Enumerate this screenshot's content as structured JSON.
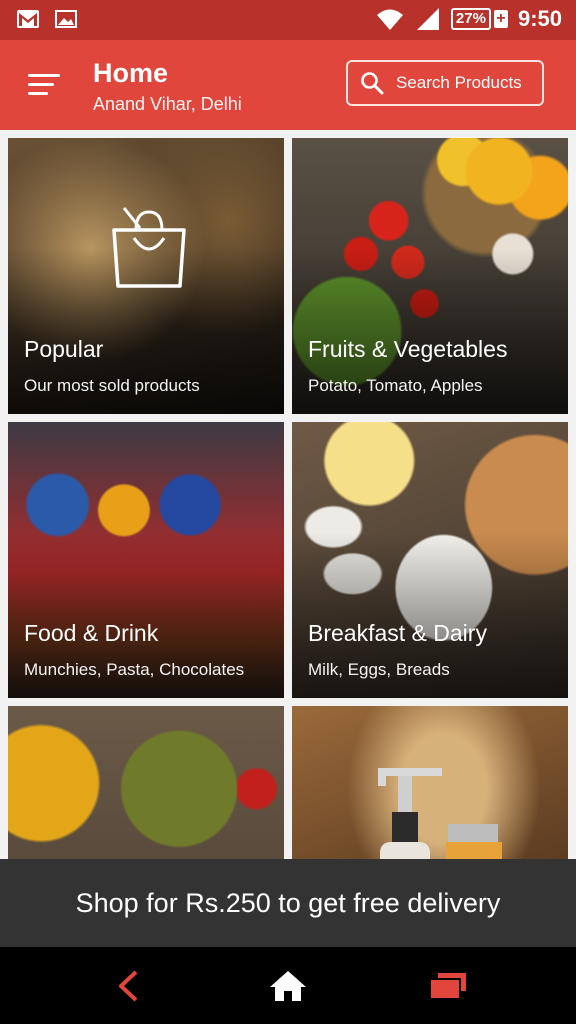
{
  "status_bar": {
    "battery": "27%",
    "time": "9:50",
    "icons": [
      "gmail-icon",
      "image-icon",
      "wifi-icon",
      "signal-icon",
      "battery-icon"
    ]
  },
  "app_bar": {
    "title": "Home",
    "location": "Anand Vihar, Delhi",
    "search_label": "Search Products",
    "accent": "#e0463b"
  },
  "categories": [
    {
      "name": "Popular",
      "desc": "Our most sold products"
    },
    {
      "name": "Fruits & Vegetables",
      "desc": "Potato, Tomato, Apples"
    },
    {
      "name": "Food & Drink",
      "desc": "Munchies, Pasta, Chocolates"
    },
    {
      "name": "Breakfast & Dairy",
      "desc": "Milk, Eggs, Breads"
    },
    {
      "name": "",
      "desc": ""
    },
    {
      "name": "",
      "desc": ""
    }
  ],
  "banner": {
    "text": "Shop for Rs.250 to get free delivery"
  },
  "nav_bar": {
    "icons": [
      "back-icon",
      "home-icon",
      "recents-icon"
    ],
    "accent": "#e0463b"
  }
}
